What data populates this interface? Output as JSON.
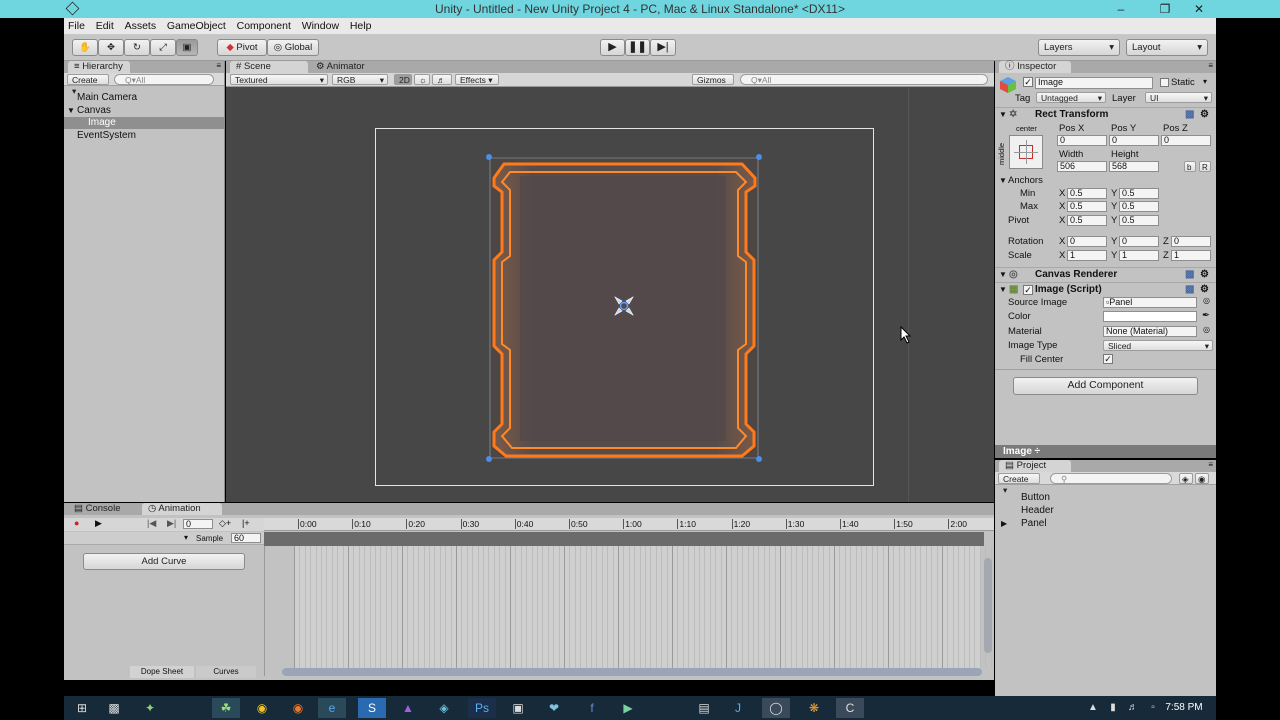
{
  "title_bar": {
    "title": "Unity - Untitled - New Unity Project 4 - PC, Mac & Linux Standalone* <DX11>"
  },
  "menu": [
    "File",
    "Edit",
    "Assets",
    "GameObject",
    "Component",
    "Window",
    "Help"
  ],
  "toolbar": {
    "pivot_label": "Pivot",
    "global_label": "Global",
    "layers_label": "Layers",
    "layout_label": "Layout"
  },
  "hierarchy": {
    "tab": "Hierarchy",
    "create_label": "Create",
    "search_placeholder": "Q▾All",
    "items": [
      "Main Camera",
      "Canvas",
      "Image",
      "EventSystem"
    ]
  },
  "scene": {
    "tab_scene": "Scene",
    "tab_animator": "Animator",
    "shading": "Textured",
    "render_mode": "RGB",
    "mode_2d": "2D",
    "effects": "Effects",
    "gizmos": "Gizmos",
    "search_placeholder": "Q▾All"
  },
  "inspector": {
    "tab": "Inspector",
    "object_name": "Image",
    "static_label": "Static",
    "tag_label": "Tag",
    "tag_value": "Untagged",
    "layer_label": "Layer",
    "layer_value": "UI",
    "rect_transform": {
      "header": "Rect Transform",
      "anchor_h": "center",
      "anchor_v": "middle",
      "pos_x_label": "Pos X",
      "pos_y_label": "Pos Y",
      "pos_z_label": "Pos Z",
      "pos_x": "0",
      "pos_y": "0",
      "pos_z": "0",
      "width_label": "Width",
      "height_label": "Height",
      "width": "506",
      "height": "568",
      "btn_b": "b",
      "btn_r": "R",
      "anchors_label": "Anchors",
      "min_label": "Min",
      "max_label": "Max",
      "pivot_label": "Pivot",
      "x": "X",
      "y": "Y",
      "z": "Z",
      "min_x": "0.5",
      "min_y": "0.5",
      "max_x": "0.5",
      "max_y": "0.5",
      "pivot_x": "0.5",
      "pivot_y": "0.5",
      "rotation_label": "Rotation",
      "rot_x": "0",
      "rot_y": "0",
      "rot_z": "0",
      "scale_label": "Scale",
      "scale_x": "1",
      "scale_y": "1",
      "scale_z": "1"
    },
    "canvas_renderer": {
      "header": "Canvas Renderer"
    },
    "image_script": {
      "header": "Image (Script)",
      "source_image_label": "Source Image",
      "source_image_value": "Panel",
      "color_label": "Color",
      "material_label": "Material",
      "material_value": "None (Material)",
      "image_type_label": "Image Type",
      "image_type_value": "Sliced",
      "fill_center_label": "Fill Center"
    },
    "add_component": "Add Component",
    "preview_label": "Image ÷"
  },
  "project": {
    "tab": "Project",
    "create_label": "Create",
    "items": [
      "Button",
      "Header",
      "Panel"
    ]
  },
  "animation": {
    "tab_console": "Console",
    "tab_animation": "Animation",
    "frame_value": "0",
    "sample_label": "Sample",
    "sample_value": "60",
    "ticks": [
      "0:00",
      "0:10",
      "0:20",
      "0:30",
      "0:40",
      "0:50",
      "1:00",
      "1:10",
      "1:20",
      "1:30",
      "1:40",
      "1:50",
      "2:00"
    ],
    "add_curve": "Add Curve",
    "dope_sheet": "Dope Sheet",
    "curves": "Curves"
  },
  "taskbar": {
    "time": "7:58 PM"
  },
  "colors": {
    "titlebar": "#6fd6df",
    "panel_frame": "#ff7f1f",
    "scene_bg": "#474747"
  }
}
